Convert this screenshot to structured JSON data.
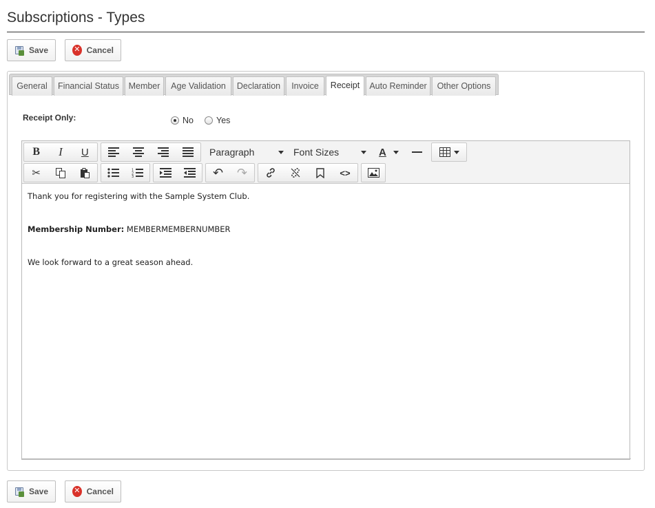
{
  "page": {
    "title": "Subscriptions - Types"
  },
  "actions": {
    "save_label": "Save",
    "cancel_label": "Cancel"
  },
  "tabs": [
    {
      "label": "General"
    },
    {
      "label": "Financial Status"
    },
    {
      "label": "Member"
    },
    {
      "label": "Age Validation"
    },
    {
      "label": "Declaration"
    },
    {
      "label": "Invoice"
    },
    {
      "label": "Receipt",
      "active": true
    },
    {
      "label": "Auto Reminder"
    },
    {
      "label": "Other Options"
    }
  ],
  "receipt_only": {
    "label": "Receipt Only:",
    "options": [
      "No",
      "Yes"
    ],
    "selected": "No"
  },
  "editor": {
    "block_format": "Paragraph",
    "font_size": "Font Sizes",
    "content": {
      "line1": "Thank you for registering with the Sample System Club.",
      "membership_label": "Membership Number:",
      "membership_value": "MEMBERMEMBERNUMBER",
      "line3": "We look forward to a great season ahead."
    }
  },
  "icons": [
    "save-icon",
    "cancel-icon",
    "bold-icon",
    "italic-icon",
    "underline-icon",
    "align-left-icon",
    "align-center-icon",
    "align-right-icon",
    "align-justify-icon",
    "text-color-icon",
    "horizontal-rule-icon",
    "table-icon",
    "cut-icon",
    "copy-icon",
    "paste-icon",
    "bullet-list-icon",
    "numbered-list-icon",
    "indent-icon",
    "outdent-icon",
    "undo-icon",
    "redo-icon",
    "link-icon",
    "unlink-icon",
    "bookmark-icon",
    "source-code-icon",
    "image-icon"
  ],
  "colors": {
    "cancel_red": "#d9322a",
    "text": "#333333",
    "toolbar_bg": "#f3f3f3"
  }
}
